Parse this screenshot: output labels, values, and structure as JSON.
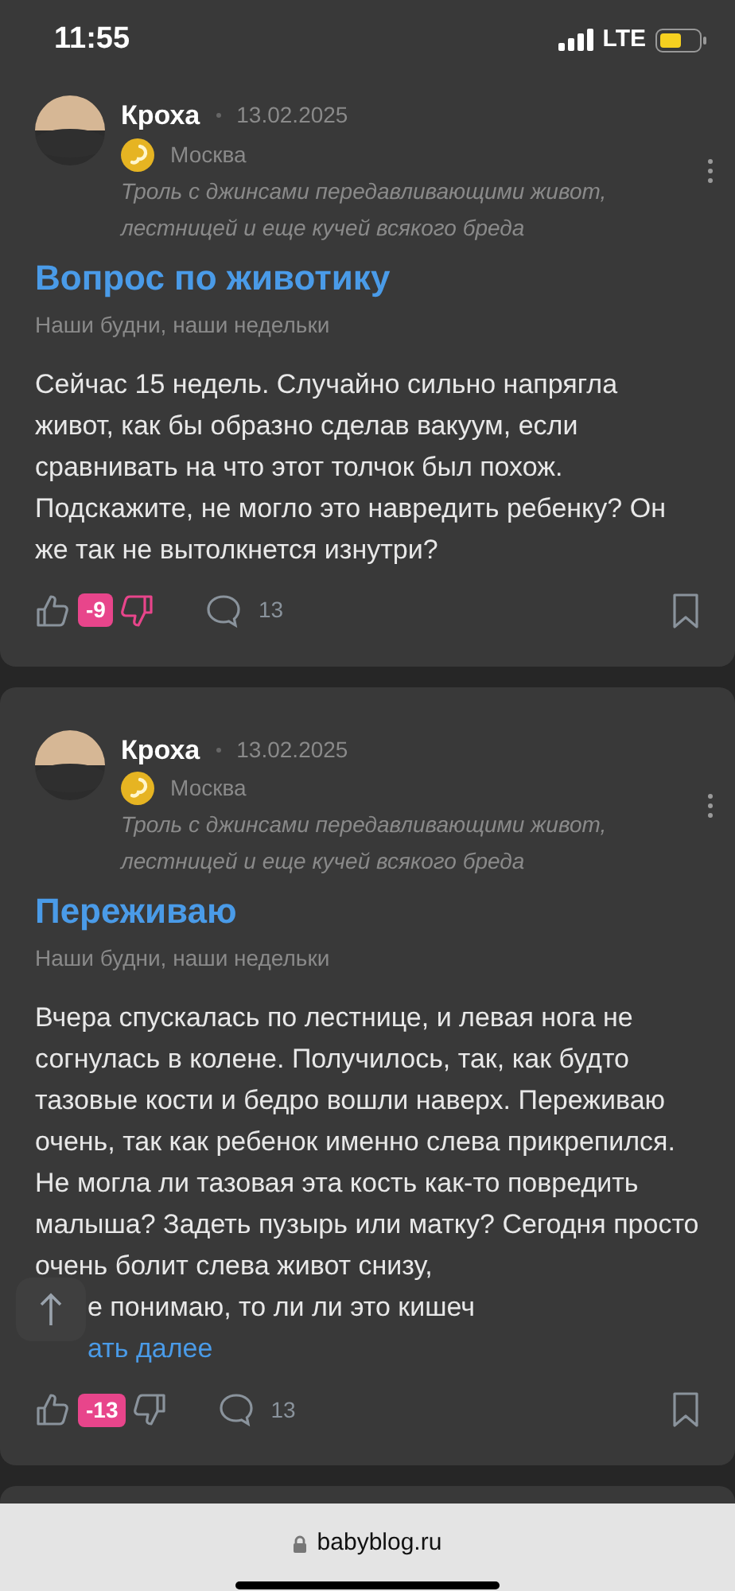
{
  "status_bar": {
    "time": "11:55",
    "network": "LTE"
  },
  "posts": [
    {
      "author": "Кроха",
      "date": "13.02.2025",
      "city": "Москва",
      "status": "Троль с джинсами передавливающими живот, лестницей и еще кучей всякого бреда",
      "title": "Вопрос по животику",
      "community": "Наши будни, наши недельки",
      "body": "Сейчас 15 недель. Случайно сильно напрягла живот, как бы образно сделав вакуум, если сравнивать на что этот толчок был похож. Подскажите, не могло это навредить ребенку? Он же так не вытолкнется изнутри?",
      "rating": "-9",
      "disliked": true,
      "comments": "13"
    },
    {
      "author": "Кроха",
      "date": "13.02.2025",
      "city": "Москва",
      "status": "Троль с джинсами передавливающими живот, лестницей и еще кучей всякого бреда",
      "title": "Переживаю",
      "community": "Наши будни, наши недельки",
      "body": "Вчера спускалась по лестнице, и левая нога не согнулась в колене. Получилось, так, как будто тазовые кости и бедро вошли наверх. Переживаю очень, так как ребенок именно слева прикрепился. Не могла ли тазовая эта кость как-то повредить малыша? Задеть пузырь или матку? Сегодня просто очень болит слева живот снизу,",
      "body_tail": "е понимаю, то ли ли это кишеч",
      "read_more": "ать далее",
      "rating": "-13",
      "disliked": false,
      "comments": "13"
    }
  ],
  "address_bar": {
    "url": "babyblog.ru"
  }
}
